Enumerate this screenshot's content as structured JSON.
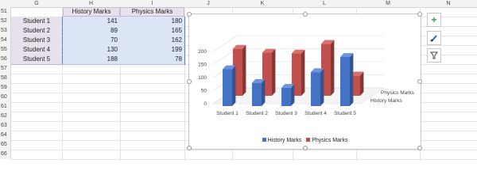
{
  "columns": [
    "G",
    "H",
    "I",
    "J",
    "K",
    "L",
    "M",
    "N"
  ],
  "rows": [
    "51",
    "52",
    "53",
    "54",
    "55",
    "56",
    "57",
    "58",
    "59",
    "60",
    "61",
    "62",
    "63",
    "64",
    "65",
    "66"
  ],
  "table": {
    "headers": [
      "History Marks",
      "Physics Marks"
    ],
    "students": [
      "Student 1",
      "Student 2",
      "Student 3",
      "Student 4",
      "Student 5"
    ],
    "history": [
      "141",
      "89",
      "70",
      "130",
      "188"
    ],
    "physics": [
      "180",
      "165",
      "162",
      "199",
      "78"
    ]
  },
  "chart_data": {
    "type": "bar",
    "categories": [
      "Student 1",
      "Student 2",
      "Student 3",
      "Student 4",
      "Student 5"
    ],
    "series": [
      {
        "name": "History Marks",
        "values": [
          141,
          89,
          70,
          130,
          188
        ],
        "color": "#4472c4"
      },
      {
        "name": "Physics Marks",
        "values": [
          180,
          165,
          162,
          199,
          78
        ],
        "color": "#c0504d"
      }
    ],
    "yticks": [
      "0",
      "50",
      "100",
      "150",
      "200"
    ],
    "ylim": [
      0,
      200
    ],
    "depth_labels": [
      "Physics Marks",
      "History Marks"
    ],
    "legend": "bottom",
    "grid": true
  },
  "side_buttons": {
    "add": "+",
    "style": "brush-icon",
    "filter": "filter-icon"
  }
}
